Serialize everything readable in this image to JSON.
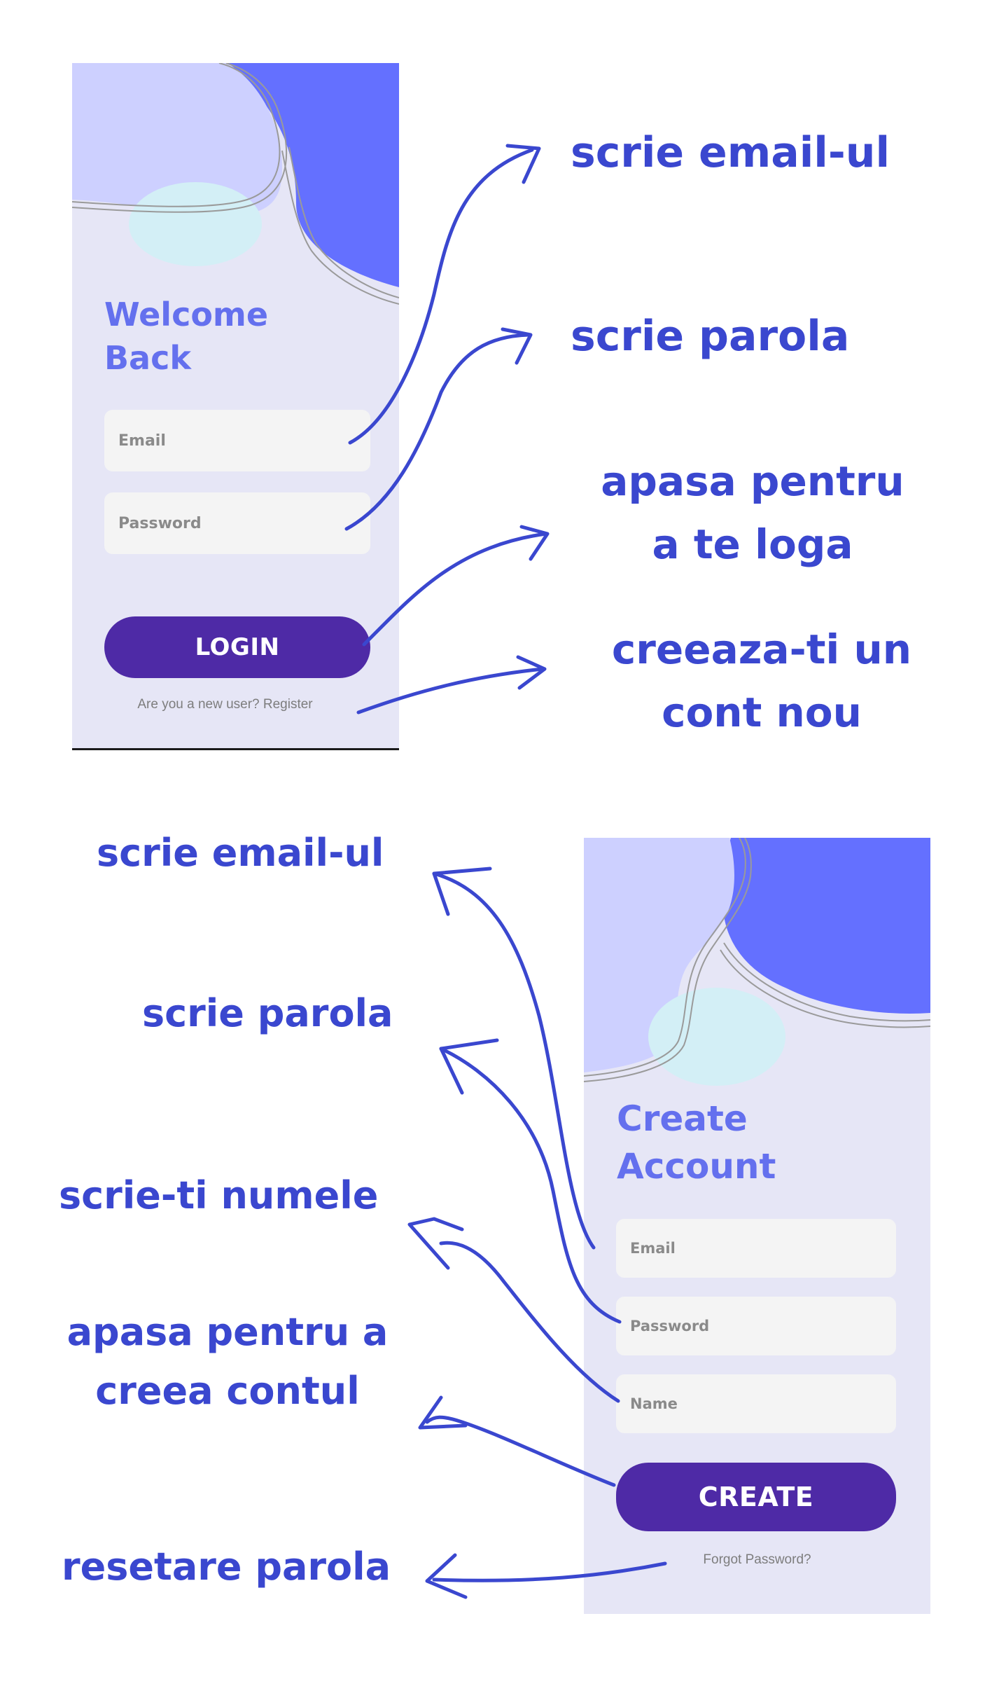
{
  "login_screen": {
    "title_line1": "Welcome",
    "title_line2": "Back",
    "email_placeholder": "Email",
    "password_placeholder": "Password",
    "login_button": "LOGIN",
    "register_link": "Are you a new user? Register"
  },
  "create_screen": {
    "title_line1": "Create",
    "title_line2": "Account",
    "email_placeholder": "Email",
    "password_placeholder": "Password",
    "name_placeholder": "Name",
    "create_button": "CREATE",
    "forgot_link": "Forgot Password?"
  },
  "annotations_login": {
    "email": "scrie email-ul",
    "password": "scrie parola",
    "login_line1": "apasa pentru",
    "login_line2": "a te loga",
    "register_line1": "creeaza-ti un",
    "register_line2": "cont nou"
  },
  "annotations_create": {
    "email": "scrie email-ul",
    "password": "scrie parola",
    "name": "scrie-ti numele",
    "create_line1": "apasa pentru a",
    "create_line2": "creea contul",
    "forgot": "resetare parola"
  },
  "colors": {
    "accent_title": "#6470ee",
    "button": "#4e2aa6",
    "screen_background": "#e6e6f6",
    "field_background": "#f4f4f4",
    "annotation": "#3a47cf"
  }
}
